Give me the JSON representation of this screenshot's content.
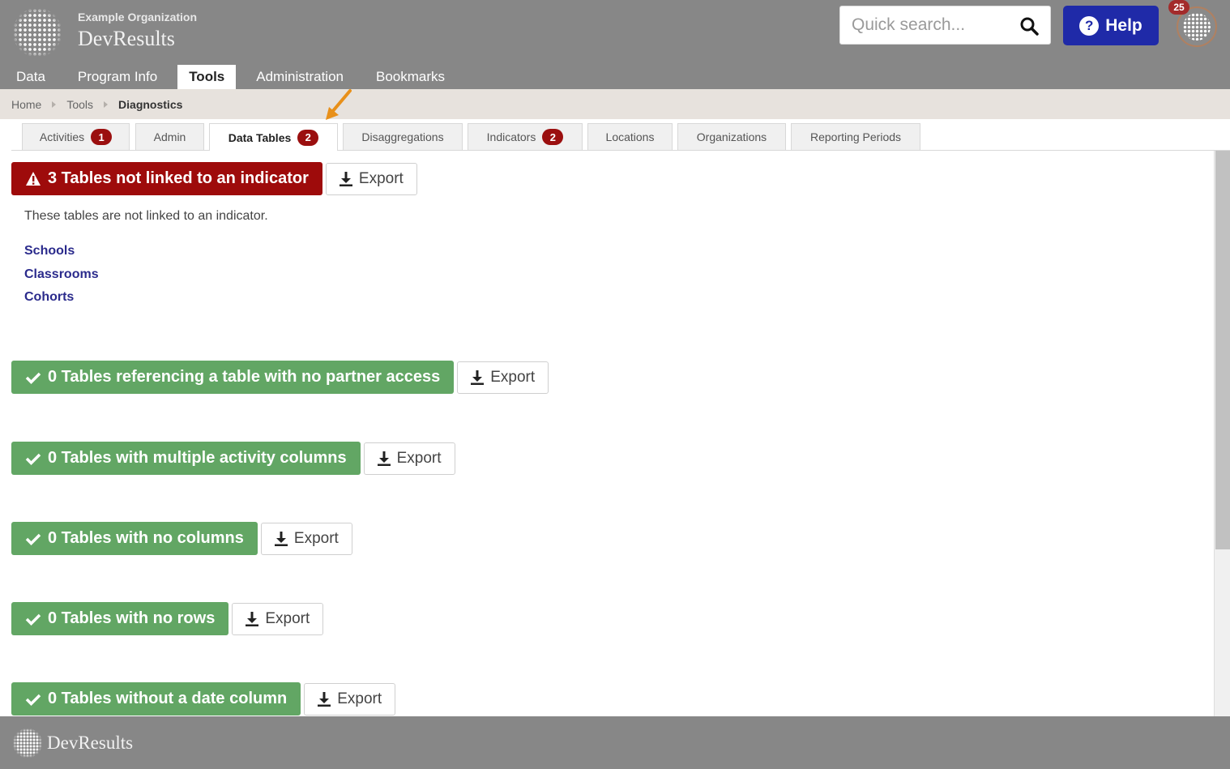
{
  "header": {
    "org_name": "Example Organization",
    "app_name": "DevResults",
    "search_placeholder": "Quick search...",
    "help_label": "Help",
    "notification_count": "25",
    "background_color": "#878787",
    "help_color": "#1f2aa8"
  },
  "nav": {
    "items": [
      {
        "label": "Data",
        "active": false
      },
      {
        "label": "Program Info",
        "active": false
      },
      {
        "label": "Tools",
        "active": true
      },
      {
        "label": "Administration",
        "active": false
      },
      {
        "label": "Bookmarks",
        "active": false
      }
    ]
  },
  "breadcrumb": {
    "items": [
      "Home",
      "Tools",
      "Diagnostics"
    ]
  },
  "tabs": {
    "items": [
      {
        "label": "Activities",
        "badge": "1"
      },
      {
        "label": "Admin",
        "badge": ""
      },
      {
        "label": "Data Tables",
        "badge": "2",
        "active": true
      },
      {
        "label": "Disaggregations",
        "badge": ""
      },
      {
        "label": "Indicators",
        "badge": "2"
      },
      {
        "label": "Locations",
        "badge": ""
      },
      {
        "label": "Organizations",
        "badge": ""
      },
      {
        "label": "Reporting Periods",
        "badge": ""
      }
    ],
    "badge_color": "#9b0f0f"
  },
  "sections": [
    {
      "status": "warning",
      "label": "3 Tables not linked to an indicator",
      "export": "Export",
      "color": "#9e0b0b"
    },
    {
      "status": "ok",
      "label": "0 Tables referencing a table with no partner access",
      "export": "Export",
      "color": "#62a664"
    },
    {
      "status": "ok",
      "label": "0 Tables with multiple activity columns",
      "export": "Export",
      "color": "#62a664"
    },
    {
      "status": "ok",
      "label": "0 Tables with no columns",
      "export": "Export",
      "color": "#62a664"
    },
    {
      "status": "ok",
      "label": "0 Tables with no rows",
      "export": "Export",
      "color": "#62a664"
    },
    {
      "status": "ok",
      "label": "0 Tables without a date column",
      "export": "Export",
      "color": "#62a664"
    }
  ],
  "unlinked": {
    "description": "These tables are not linked to an indicator.",
    "tables": [
      "Schools",
      "Classrooms",
      "Cohorts"
    ]
  },
  "footer": {
    "app_name": "DevResults"
  },
  "icons": {
    "search": "search-icon",
    "help": "question-circle-icon",
    "warning": "warning-triangle-icon",
    "check": "check-icon",
    "export": "download-icon"
  }
}
